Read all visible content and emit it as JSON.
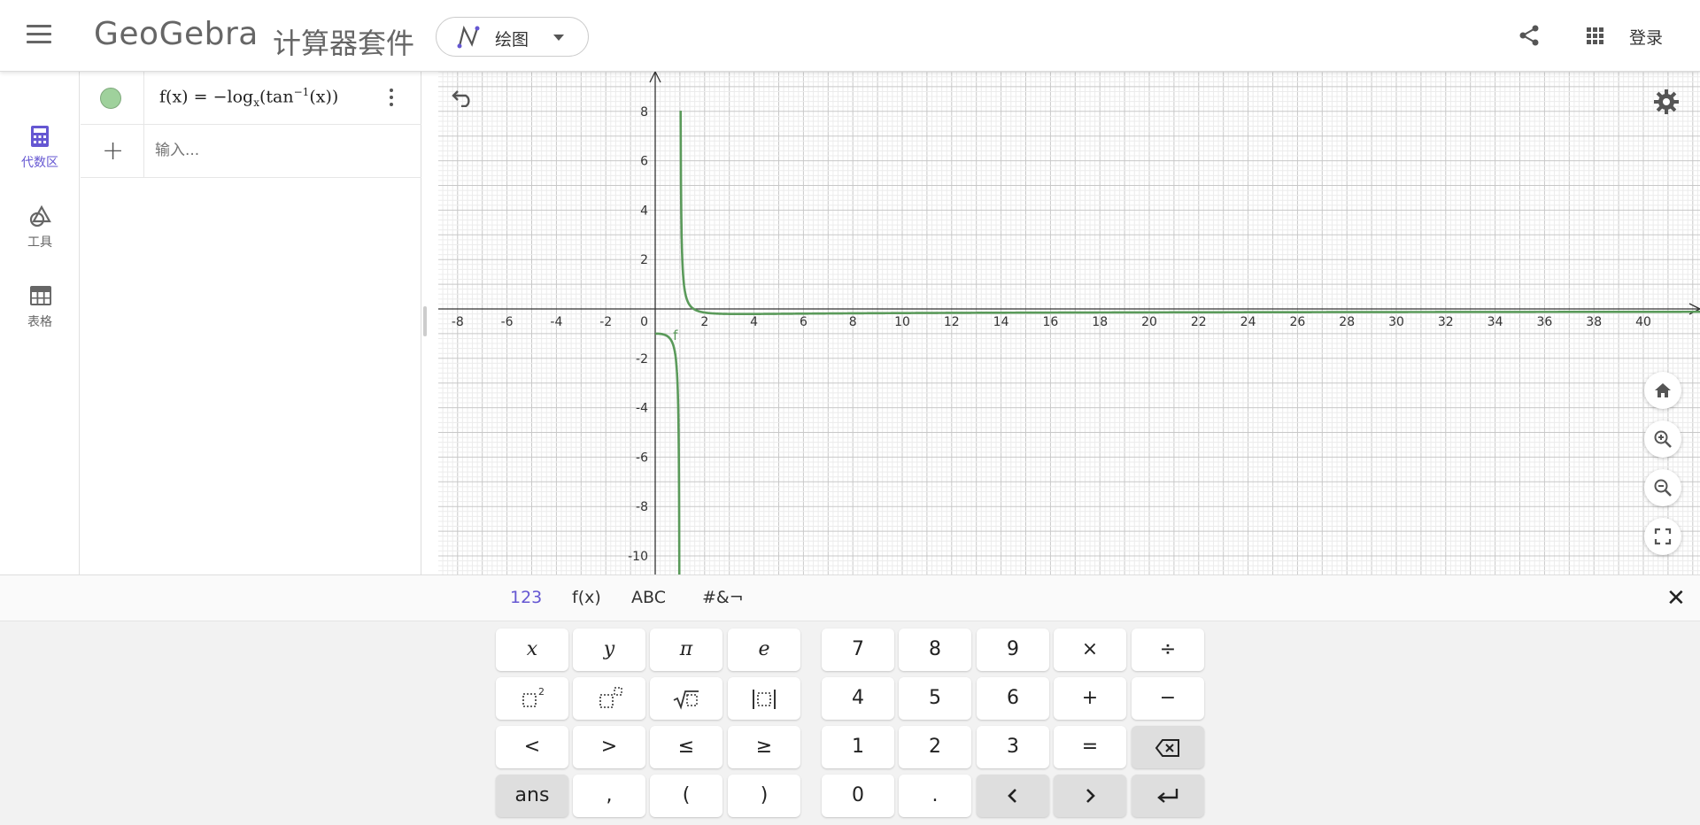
{
  "header": {
    "logo": "GeoGebra",
    "suite_title": "计算器套件",
    "app_picker_label": "绘图",
    "login_label": "登录"
  },
  "nav": {
    "items": [
      {
        "label": "代数区",
        "icon": "calculator-icon",
        "active": true
      },
      {
        "label": "工具",
        "icon": "shapes-icon",
        "active": false
      },
      {
        "label": "表格",
        "icon": "table-icon",
        "active": false
      }
    ]
  },
  "algebra": {
    "entry": {
      "name": "f(x)",
      "eq": "=",
      "neg": "−",
      "log": "log",
      "base": "x",
      "fn": "tan",
      "exp": "−1",
      "arg": "(x)",
      "color": "#9fd19c"
    },
    "input_placeholder": "输入..."
  },
  "graph": {
    "curve_label": "f",
    "curve_color": "#5a9a5a",
    "x_ticks": [
      "-8",
      "-6",
      "-4",
      "-2",
      "2",
      "4",
      "6",
      "8",
      "10",
      "12",
      "14",
      "16",
      "18",
      "20",
      "22",
      "24",
      "26",
      "28",
      "30",
      "32",
      "34",
      "36",
      "38",
      "40"
    ],
    "y_ticks": [
      "8",
      "6",
      "4",
      "2",
      "-2",
      "-4",
      "-6",
      "-8",
      "-10"
    ],
    "origin_label": "0"
  },
  "keyboard": {
    "tabs": [
      "123",
      "f(x)",
      "ABC",
      "#&¬"
    ],
    "left_keys": [
      [
        "x",
        "y",
        "π",
        "e"
      ],
      [
        "sq",
        "pow",
        "sqrt",
        "abs"
      ],
      [
        "<",
        ">",
        "≤",
        "≥"
      ],
      [
        "ans",
        ",",
        "(",
        ")"
      ]
    ],
    "right_keys": [
      [
        "7",
        "8",
        "9",
        "×",
        "÷"
      ],
      [
        "4",
        "5",
        "6",
        "+",
        "−"
      ],
      [
        "1",
        "2",
        "3",
        "=",
        "backspace"
      ],
      [
        "0",
        ".",
        "left",
        "right",
        "enter"
      ]
    ]
  }
}
